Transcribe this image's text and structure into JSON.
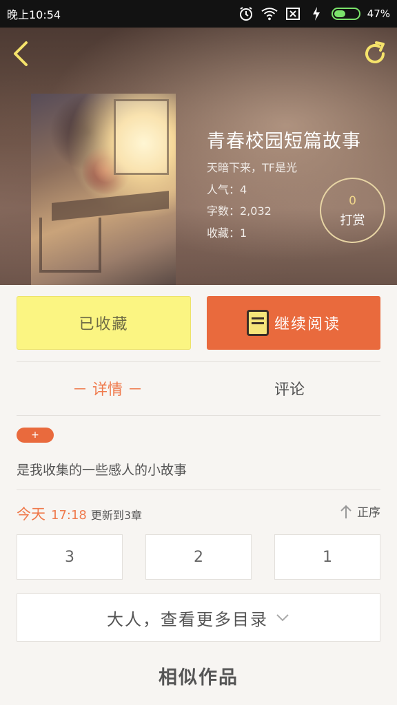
{
  "status_bar": {
    "time": "晚上10:54",
    "battery_percent": "47%",
    "battery_level": 0.47
  },
  "header": {
    "back_icon": "back-chevron-icon",
    "refresh_icon": "refresh-icon",
    "accent_color": "#f5e36b"
  },
  "book": {
    "title": "青春校园短篇故事",
    "author_line": "天暗下来，TF是光",
    "popularity": "人气：4",
    "word_count": "字数：2,032",
    "favorites": "收藏：1"
  },
  "reward": {
    "count": "0",
    "label": "打赏"
  },
  "actions": {
    "collect_label": "已收藏",
    "read_label": "继续阅读",
    "read_icon": "book-icon"
  },
  "tabs": {
    "details": "－ 详情 －",
    "comments": "评论"
  },
  "details": {
    "tag": "+",
    "description": "是我收集的一些感人的小故事"
  },
  "update": {
    "today": "今天",
    "time": "17:18",
    "text": "更新到3章",
    "sort_label": "正序",
    "sort_icon": "up-arrow-icon"
  },
  "chapters": [
    "3",
    "2",
    "1"
  ],
  "more_catalog": {
    "label": "大人，查看更多目录",
    "icon": "chevron-down-icon"
  },
  "similar": {
    "title": "相似作品"
  },
  "colors": {
    "orange": "#e96a3d",
    "yellow_button": "#fbf582",
    "status_bar": "#121212"
  }
}
